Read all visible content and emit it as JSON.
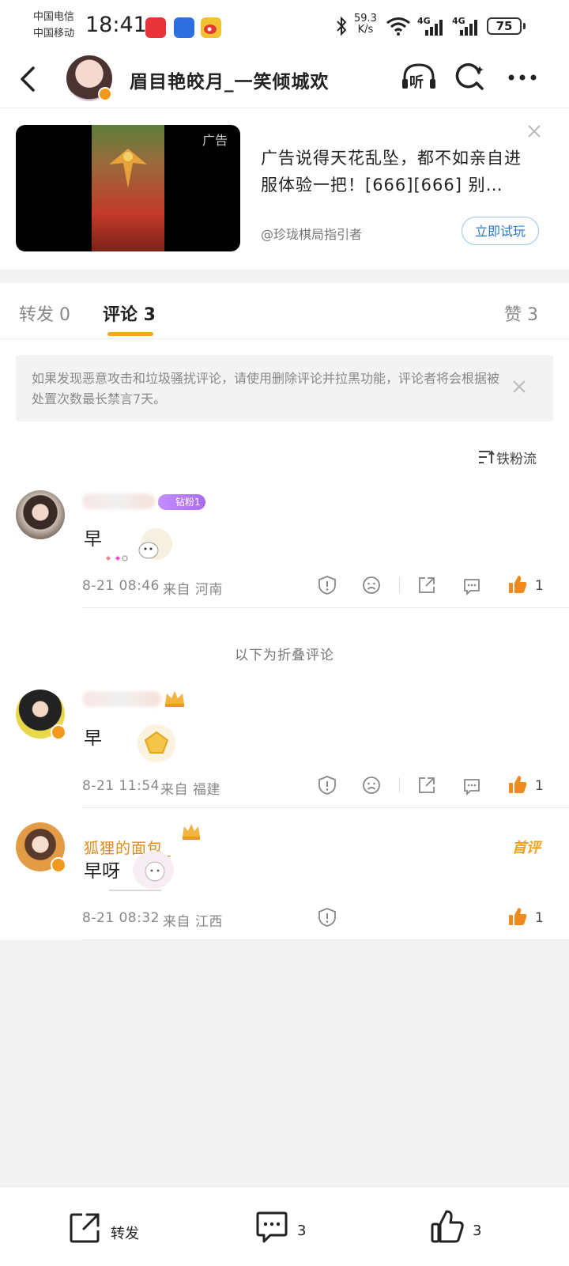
{
  "status_bar": {
    "carrier_1": "中国电信",
    "carrier_2": "中国移动",
    "time": "18:41",
    "net_speed_value": "59.3",
    "net_speed_unit": "K/s",
    "signal_1": "4G",
    "signal_2": "4G",
    "battery": "75"
  },
  "header": {
    "title": "眉目艳皎月_一笑倾城欢",
    "listen_label": "听"
  },
  "ad": {
    "tag": "广告",
    "text": "广告说得天花乱坠，都不如亲自进服体验一把！[666][666] 别…",
    "source": "@珍珑棋局指引者",
    "button": "立即试玩"
  },
  "tabs": [
    {
      "label": "转发 0"
    },
    {
      "label": "评论 3"
    },
    {
      "label": "赞 3"
    }
  ],
  "notice": {
    "text": "如果发现恶意攻击和垃圾骚扰评论，请使用删除评论并拉黑功能，评论者将会根据被处置次数最长禁言7天。"
  },
  "sort_label": "铁粉流",
  "comments": [
    {
      "fan_badge": "钻粉1",
      "text": "早",
      "time": "8-21 08:46",
      "location": "来自 河南",
      "likes": "1"
    },
    {
      "text": "早",
      "time": "8-21 11:54",
      "location": "来自 福建",
      "likes": "1"
    },
    {
      "username": "狐狸的面包_",
      "hot_label": "首评",
      "text": "早呀",
      "time": "8-21 08:32",
      "location": "来自 江西",
      "likes": "1"
    }
  ],
  "folded_label": "以下为折叠评论",
  "bottom_bar": {
    "repost": "转发",
    "comment_count": "3",
    "like_count": "3"
  },
  "colors": {
    "accent": "#f5a623",
    "like": "#f08a1e",
    "link": "#2a78c4"
  }
}
